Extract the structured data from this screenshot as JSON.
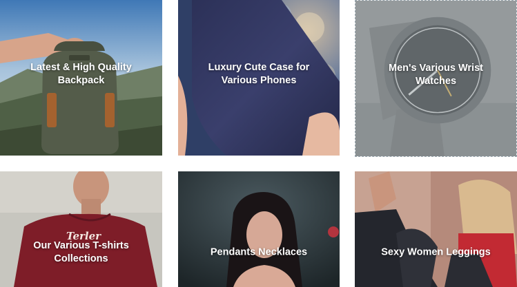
{
  "categories": [
    {
      "title": "Latest & High Quality\nBackpack"
    },
    {
      "title": "Luxury Cute Case for\nVarious Phones"
    },
    {
      "title": "Men's Various Wrist\nWatches"
    },
    {
      "title": "Our Various T-shirts\nCollections",
      "shirt_print": "Terler"
    },
    {
      "title": "Pendants Necklaces"
    },
    {
      "title": "Sexy Women Leggings"
    }
  ],
  "colors": {
    "label_text": "#ffffff",
    "hover_border": "#9aa7b0"
  }
}
